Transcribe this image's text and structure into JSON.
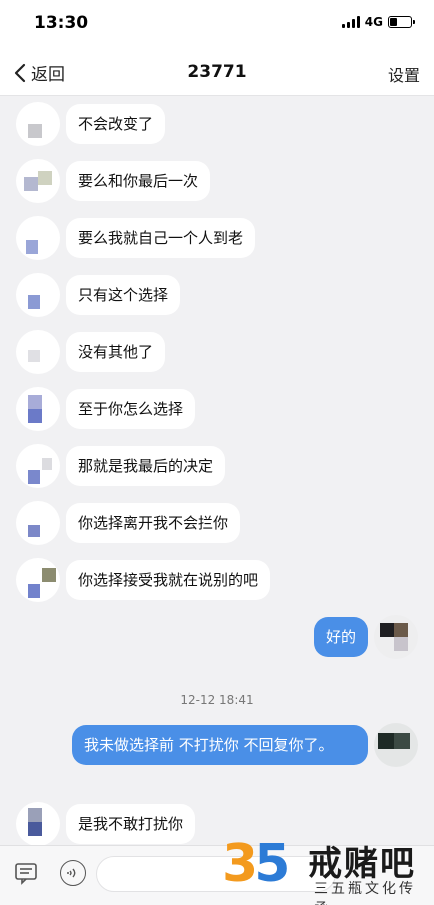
{
  "status_bar": {
    "time": "13:30",
    "network": "4G"
  },
  "nav": {
    "back_label": "返回",
    "title": "23771",
    "settings_label": "设置"
  },
  "messages": [
    {
      "side": "left",
      "text": "不会改变了"
    },
    {
      "side": "left",
      "text": "要么和你最后一次"
    },
    {
      "side": "left",
      "text": "要么我就自己一个人到老"
    },
    {
      "side": "left",
      "text": "只有这个选择"
    },
    {
      "side": "left",
      "text": "没有其他了"
    },
    {
      "side": "left",
      "text": "至于你怎么选择"
    },
    {
      "side": "left",
      "text": "那就是我最后的决定"
    },
    {
      "side": "left",
      "text": "你选择离开我不会拦你"
    },
    {
      "side": "left",
      "text": "你选择接受我就在说别的吧"
    },
    {
      "side": "right",
      "text": "好的"
    },
    {
      "side": "right",
      "text": "我未做选择前 不打扰你 不回复你了。"
    },
    {
      "side": "left",
      "text": "是我不敢打扰你"
    }
  ],
  "timestamp": "12-12 18:41",
  "watermark": {
    "number_3": "3",
    "number_5": "5",
    "title": "戒赌吧",
    "subtitle": "三五瓶文化传承"
  },
  "icons": {
    "back": "chevron-left-icon",
    "keyboard": "keyboard-icon",
    "voice": "voice-icon"
  },
  "colors": {
    "outgoing_bubble": "#4a8fe7",
    "incoming_bubble": "#ffffff",
    "background": "#f1f1f3"
  }
}
